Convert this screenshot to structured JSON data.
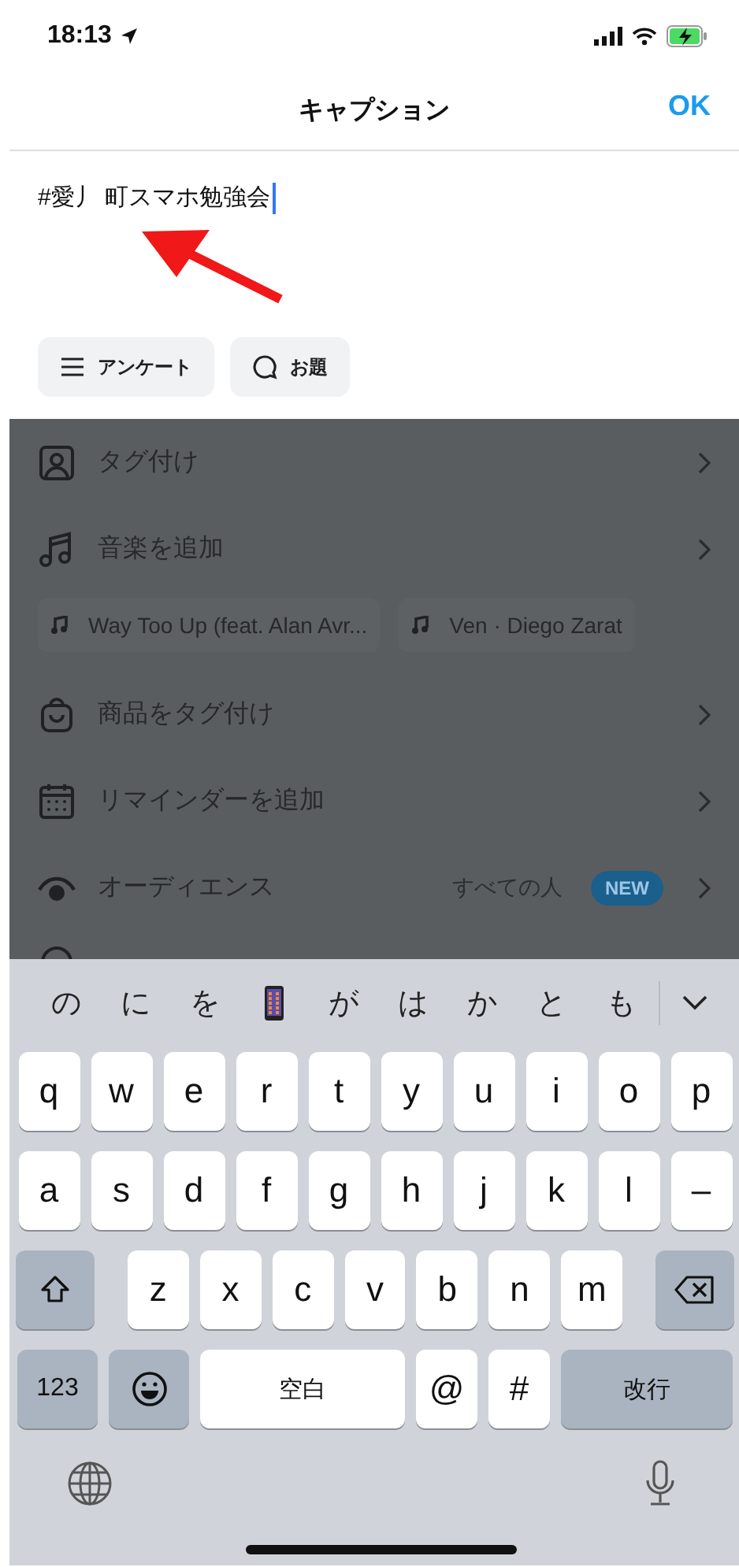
{
  "status_bar": {
    "time": "18:13"
  },
  "header": {
    "title": "キャプション",
    "done": "OK"
  },
  "caption": {
    "value": "#愛丿 町スマホ勉強会"
  },
  "chips": [
    {
      "label": "アンケート"
    },
    {
      "label": "お題"
    }
  ],
  "menu": [
    {
      "kind": "row",
      "label": "タグ付け"
    },
    {
      "kind": "row",
      "label": "音楽を追加"
    },
    {
      "kind": "songs",
      "songs": [
        "Way Too Up (feat. Alan Avr...",
        "Ven · Diego Zarat"
      ]
    },
    {
      "kind": "row",
      "label": "商品をタグ付け"
    },
    {
      "kind": "row",
      "label": "リマインダーを追加"
    },
    {
      "kind": "row",
      "label": "オーディエンス",
      "value": "すべての人",
      "badge": "NEW"
    },
    {
      "kind": "cut"
    }
  ],
  "keyboard": {
    "candidates": [
      {
        "kind": "text",
        "text": "の"
      },
      {
        "kind": "text",
        "text": "に"
      },
      {
        "kind": "text",
        "text": "を"
      },
      {
        "kind": "phone"
      },
      {
        "kind": "text",
        "text": "が"
      },
      {
        "kind": "text",
        "text": "は"
      },
      {
        "kind": "text",
        "text": "か"
      },
      {
        "kind": "text",
        "text": "と"
      },
      {
        "kind": "text",
        "text": "も"
      }
    ],
    "key_rows": [
      {
        "keys": [
          {
            "kind": "letter",
            "text": "q"
          },
          {
            "kind": "letter",
            "text": "w"
          },
          {
            "kind": "letter",
            "text": "e"
          },
          {
            "kind": "letter",
            "text": "r"
          },
          {
            "kind": "letter",
            "text": "t"
          },
          {
            "kind": "letter",
            "text": "y"
          },
          {
            "kind": "letter",
            "text": "u"
          },
          {
            "kind": "letter",
            "text": "i"
          },
          {
            "kind": "letter",
            "text": "o"
          },
          {
            "kind": "letter",
            "text": "p"
          }
        ]
      },
      {
        "keys": [
          {
            "kind": "letter",
            "text": "a"
          },
          {
            "kind": "letter",
            "text": "s"
          },
          {
            "kind": "letter",
            "text": "d"
          },
          {
            "kind": "letter",
            "text": "f"
          },
          {
            "kind": "letter",
            "text": "g"
          },
          {
            "kind": "letter",
            "text": "h"
          },
          {
            "kind": "letter",
            "text": "j"
          },
          {
            "kind": "letter",
            "text": "k"
          },
          {
            "kind": "letter",
            "text": "l"
          },
          {
            "kind": "letter",
            "text": "–"
          }
        ]
      },
      {
        "keys": [
          {
            "kind": "shift"
          },
          {
            "kind": "letter",
            "text": "z"
          },
          {
            "kind": "letter",
            "text": "x"
          },
          {
            "kind": "letter",
            "text": "c"
          },
          {
            "kind": "letter",
            "text": "v"
          },
          {
            "kind": "letter",
            "text": "b"
          },
          {
            "kind": "letter",
            "text": "n"
          },
          {
            "kind": "letter",
            "text": "m"
          },
          {
            "kind": "delete"
          }
        ]
      },
      {
        "keys": [
          {
            "kind": "numbers",
            "text": "123"
          },
          {
            "kind": "emoji"
          },
          {
            "kind": "space",
            "text": "空白"
          },
          {
            "kind": "letter",
            "text": "@"
          },
          {
            "kind": "letter",
            "text": "#"
          },
          {
            "kind": "return",
            "text": "改行"
          }
        ]
      }
    ]
  }
}
